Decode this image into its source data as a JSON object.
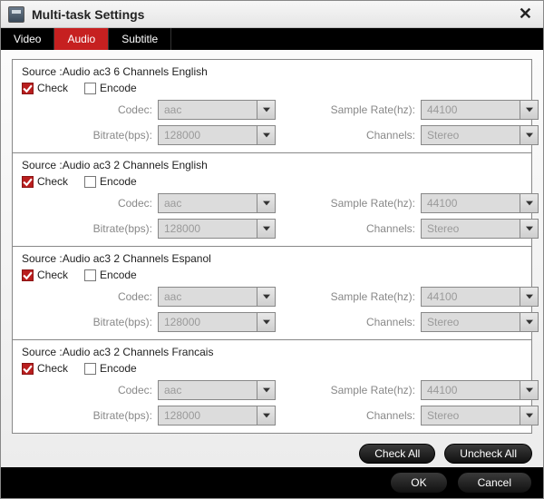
{
  "window": {
    "title": "Multi-task Settings",
    "close_glyph": "✕"
  },
  "tabs": [
    {
      "label": "Video",
      "active": false
    },
    {
      "label": "Audio",
      "active": true
    },
    {
      "label": "Subtitle",
      "active": false
    }
  ],
  "labels": {
    "check": "Check",
    "encode": "Encode",
    "codec": "Codec:",
    "sample_rate": "Sample Rate(hz):",
    "bitrate": "Bitrate(bps):",
    "channels": "Channels:"
  },
  "sources": [
    {
      "title": "Source :Audio  ac3  6 Channels  English",
      "check": true,
      "encode": false,
      "codec": "aac",
      "sample_rate": "44100",
      "bitrate": "128000",
      "channels": "Stereo"
    },
    {
      "title": "Source :Audio  ac3  2 Channels  English",
      "check": true,
      "encode": false,
      "codec": "aac",
      "sample_rate": "44100",
      "bitrate": "128000",
      "channels": "Stereo"
    },
    {
      "title": "Source :Audio  ac3  2 Channels  Espanol",
      "check": true,
      "encode": false,
      "codec": "aac",
      "sample_rate": "44100",
      "bitrate": "128000",
      "channels": "Stereo"
    },
    {
      "title": "Source :Audio  ac3  2 Channels  Francais",
      "check": true,
      "encode": false,
      "codec": "aac",
      "sample_rate": "44100",
      "bitrate": "128000",
      "channels": "Stereo"
    }
  ],
  "buttons": {
    "check_all": "Check All",
    "uncheck_all": "Uncheck All",
    "ok": "OK",
    "cancel": "Cancel"
  }
}
